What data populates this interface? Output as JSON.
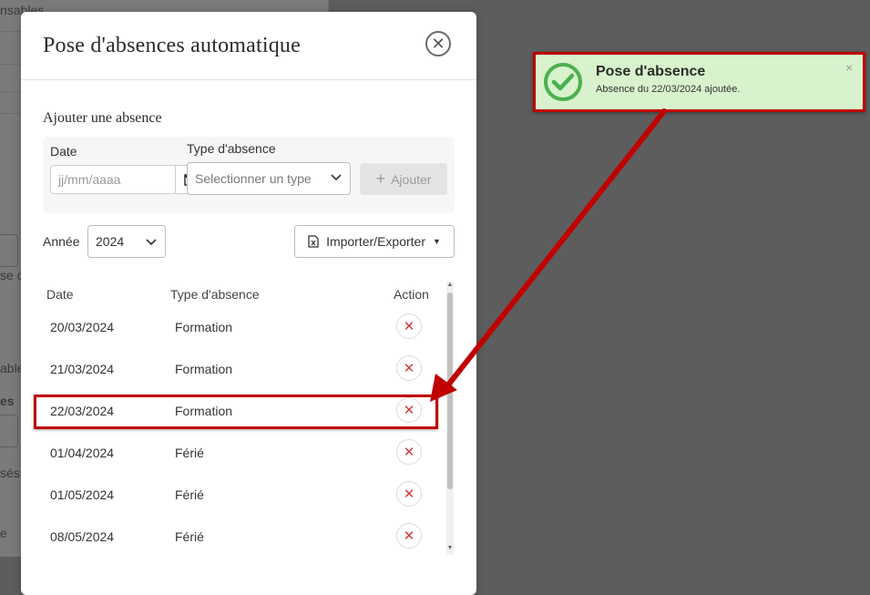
{
  "background": {
    "texts": [
      "nsables",
      "se c",
      "able",
      "es",
      "sés",
      "e"
    ]
  },
  "modal": {
    "title": "Pose d'absences automatique",
    "close_icon": "close-icon",
    "section_title": "Ajouter une absence",
    "form": {
      "date_label": "Date",
      "date_placeholder": "jj/mm/aaaa",
      "type_label": "Type d'absence",
      "type_placeholder": "Selectionner un type",
      "add_label": "Ajouter"
    },
    "year_label": "Année",
    "year_value": "2024",
    "import_export_label": "Importer/Exporter",
    "table": {
      "headers": [
        "Date",
        "Type d'absence",
        "Action"
      ],
      "rows": [
        {
          "date": "20/03/2024",
          "type": "Formation"
        },
        {
          "date": "21/03/2024",
          "type": "Formation"
        },
        {
          "date": "22/03/2024",
          "type": "Formation"
        },
        {
          "date": "01/04/2024",
          "type": "Férié"
        },
        {
          "date": "01/05/2024",
          "type": "Férié"
        },
        {
          "date": "08/05/2024",
          "type": "Férié"
        }
      ]
    }
  },
  "toast": {
    "title": "Pose d'absence",
    "message": "Absence du 22/03/2024 ajoutée.",
    "icon": "check-circle-icon",
    "close": "×"
  },
  "colors": {
    "accent_red": "#c00000",
    "toast_bg": "#d7f2cc",
    "success_green": "#4caf50",
    "delete_red": "#d03a3a"
  }
}
